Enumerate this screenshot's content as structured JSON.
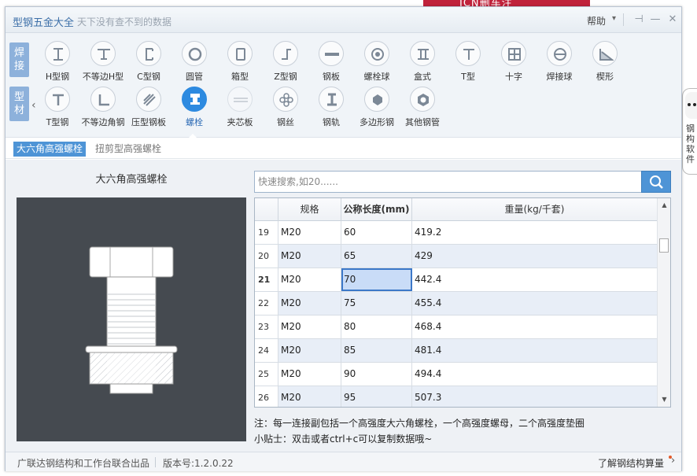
{
  "background": {
    "ad_text": "ICN删车注",
    "mascot_text": "钢构软件"
  },
  "window": {
    "title": "型钢五金大全",
    "subtitle": "天下没有查不到的数据",
    "help_label": "帮助",
    "caret": "▾",
    "pin": "⊣",
    "minimize": "—",
    "close": "✕"
  },
  "toolbar": {
    "side_tabs": [
      "焊接",
      "型材"
    ],
    "row1": [
      "H型钢",
      "不等边H型",
      "C型钢",
      "圆管",
      "箱型",
      "Z型钢",
      "钢板",
      "螺栓球",
      "盒式",
      "T型",
      "十字",
      "焊接球",
      "楔形"
    ],
    "row2": [
      "T型钢",
      "不等边角钢",
      "压型钢板",
      "螺栓",
      "夹芯板",
      "钢丝",
      "钢轨",
      "多边形钢",
      "其他钢管"
    ],
    "active": "螺栓"
  },
  "subtabs": [
    "大六角高强螺栓",
    "扭剪型高强螺栓"
  ],
  "left_panel": {
    "title": "大六角高强螺栓"
  },
  "search": {
    "placeholder": "快速搜索,如20......"
  },
  "table": {
    "headers": [
      "",
      "规格",
      "公称长度(mm)",
      "重量(kg/千套)"
    ],
    "rows": [
      [
        "19",
        "M20",
        "60",
        "419.2"
      ],
      [
        "20",
        "M20",
        "65",
        "429"
      ],
      [
        "21",
        "M20",
        "70",
        "442.4"
      ],
      [
        "22",
        "M20",
        "75",
        "455.4"
      ],
      [
        "23",
        "M20",
        "80",
        "468.4"
      ],
      [
        "24",
        "M20",
        "85",
        "481.4"
      ],
      [
        "25",
        "M20",
        "90",
        "494.4"
      ],
      [
        "26",
        "M20",
        "95",
        "507.3"
      ]
    ],
    "selected_row": "21",
    "scroll": {
      "up": "▲",
      "down": "▼"
    }
  },
  "notes": {
    "note": "注：每一连接副包括一个高强度大六角螺栓，一个高强度螺母，二个高强度垫圈",
    "tip": "小贴士：双击或者ctrl+c可以复制数据哦~"
  },
  "status": {
    "credit": "广联达钢结构和工作台联合出品",
    "version": "版本号:1.2.0.22",
    "learn": "了解钢结构算量",
    "chevron": "›"
  },
  "colors": {
    "accent": "#4e94d6",
    "title": "#3c6fa8",
    "selection": "#c9dcf7",
    "image_bg": "#454a50"
  }
}
